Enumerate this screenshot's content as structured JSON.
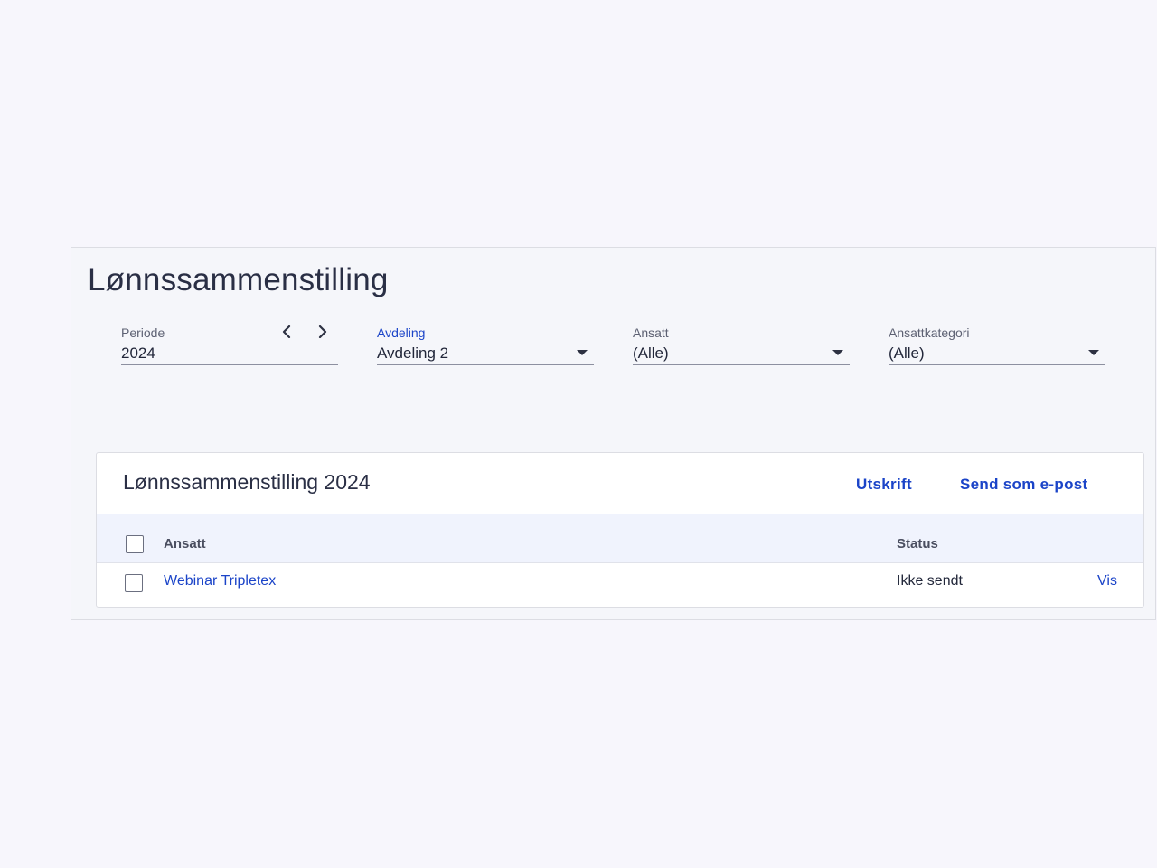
{
  "page": {
    "title": "Lønnssammenstilling"
  },
  "filters": {
    "periode": {
      "label": "Periode",
      "value": "2024"
    },
    "avdeling": {
      "label": "Avdeling",
      "value": "Avdeling 2"
    },
    "ansatt": {
      "label": "Ansatt",
      "value": "(Alle)"
    },
    "ansattkategori": {
      "label": "Ansattkategori",
      "value": "(Alle)"
    }
  },
  "card": {
    "title": "Lønnssammenstilling 2024",
    "actions": {
      "print": "Utskrift",
      "email": "Send som e-post"
    },
    "table": {
      "columns": {
        "employee": "Ansatt",
        "status": "Status"
      },
      "rows": [
        {
          "employee": "Webinar Tripletex",
          "status": "Ikke sendt",
          "action": "Vis"
        }
      ]
    }
  },
  "colors": {
    "accent": "#1b44c8",
    "page_background": "#f7f6fc",
    "panel_background": "#f5f6fa",
    "table_header_background": "#f0f3fd"
  },
  "icons": {
    "prev": "chevron-left-icon",
    "next": "chevron-right-icon",
    "dropdown": "caret-down-icon"
  }
}
